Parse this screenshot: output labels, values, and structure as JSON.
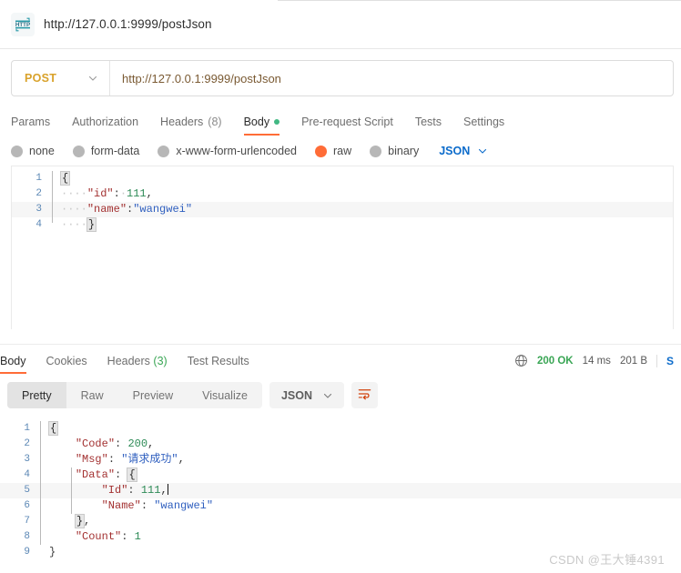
{
  "tab": {
    "icon": "http-badge-icon",
    "title": "http://127.0.0.1:9999/postJson"
  },
  "request": {
    "method": "POST",
    "method_chevron": "chevron-down-icon",
    "url": "http://127.0.0.1:9999/postJson",
    "tabs": [
      {
        "label": "Params",
        "active": false
      },
      {
        "label": "Authorization",
        "active": false
      },
      {
        "label": "Headers",
        "count": "(8)",
        "active": false
      },
      {
        "label": "Body",
        "active": true,
        "dot": true
      },
      {
        "label": "Pre-request Script",
        "active": false
      },
      {
        "label": "Tests",
        "active": false
      },
      {
        "label": "Settings",
        "active": false
      }
    ],
    "body_types": [
      {
        "label": "none",
        "selected": false
      },
      {
        "label": "form-data",
        "selected": false
      },
      {
        "label": "x-www-form-urlencoded",
        "selected": false
      },
      {
        "label": "raw",
        "selected": true
      },
      {
        "label": "binary",
        "selected": false
      }
    ],
    "format": "JSON",
    "format_chevron": "chevron-down-icon",
    "body_lines": [
      {
        "n": "1",
        "tokens": [
          {
            "t": "{",
            "c": "brace-box"
          }
        ]
      },
      {
        "n": "2",
        "tokens": [
          {
            "t": "····",
            "c": "ws"
          },
          {
            "t": "\"id\"",
            "c": "k"
          },
          {
            "t": ":",
            "c": "p"
          },
          {
            "t": "·",
            "c": "ws"
          },
          {
            "t": "111",
            "c": "n"
          },
          {
            "t": ",",
            "c": "p"
          }
        ]
      },
      {
        "n": "3",
        "tokens": [
          {
            "t": "····",
            "c": "ws"
          },
          {
            "t": "\"name\"",
            "c": "k"
          },
          {
            "t": ":",
            "c": "p"
          },
          {
            "t": "\"wangwei\"",
            "c": "s"
          }
        ],
        "hl": true
      },
      {
        "n": "4",
        "tokens": [
          {
            "t": "····",
            "c": "ws"
          },
          {
            "t": "}",
            "c": "brace-box"
          }
        ]
      }
    ]
  },
  "response": {
    "tabs": [
      {
        "label": "Body",
        "active": true
      },
      {
        "label": "Cookies",
        "active": false
      },
      {
        "label": "Headers",
        "count": "(3)",
        "active": false
      },
      {
        "label": "Test Results",
        "active": false
      }
    ],
    "globe_icon": "globe-icon",
    "status": "200 OK",
    "time": "14 ms",
    "size": "201 B",
    "save_label": "Save Response",
    "view_modes": [
      {
        "label": "Pretty",
        "active": true
      },
      {
        "label": "Raw",
        "active": false
      },
      {
        "label": "Preview",
        "active": false
      },
      {
        "label": "Visualize",
        "active": false
      }
    ],
    "format": "JSON",
    "format_chevron": "chevron-down-icon",
    "wrap_icon": "word-wrap-icon",
    "body_lines": [
      {
        "n": "1",
        "tokens": [
          {
            "t": "{",
            "c": "brace-box"
          }
        ]
      },
      {
        "n": "2",
        "tokens": [
          {
            "t": "    ",
            "c": "ws"
          },
          {
            "t": "\"Code\"",
            "c": "k"
          },
          {
            "t": ": ",
            "c": "p"
          },
          {
            "t": "200",
            "c": "n"
          },
          {
            "t": ",",
            "c": "p"
          }
        ]
      },
      {
        "n": "3",
        "tokens": [
          {
            "t": "    ",
            "c": "ws"
          },
          {
            "t": "\"Msg\"",
            "c": "k"
          },
          {
            "t": ": ",
            "c": "p"
          },
          {
            "t": "\"请求成功\"",
            "c": "s"
          },
          {
            "t": ",",
            "c": "p"
          }
        ]
      },
      {
        "n": "4",
        "tokens": [
          {
            "t": "    ",
            "c": "ws"
          },
          {
            "t": "\"Data\"",
            "c": "k"
          },
          {
            "t": ": ",
            "c": "p"
          },
          {
            "t": "{",
            "c": "brace-box"
          }
        ]
      },
      {
        "n": "5",
        "tokens": [
          {
            "t": "        ",
            "c": "ws"
          },
          {
            "t": "\"Id\"",
            "c": "k"
          },
          {
            "t": ": ",
            "c": "p"
          },
          {
            "t": "111",
            "c": "n"
          },
          {
            "t": ",",
            "c": "p"
          }
        ],
        "hl": true,
        "caret": true
      },
      {
        "n": "6",
        "tokens": [
          {
            "t": "        ",
            "c": "ws"
          },
          {
            "t": "\"Name\"",
            "c": "k"
          },
          {
            "t": ": ",
            "c": "p"
          },
          {
            "t": "\"wangwei\"",
            "c": "s"
          }
        ]
      },
      {
        "n": "7",
        "tokens": [
          {
            "t": "    ",
            "c": "ws"
          },
          {
            "t": "}",
            "c": "brace-box"
          },
          {
            "t": ",",
            "c": "p"
          }
        ]
      },
      {
        "n": "8",
        "tokens": [
          {
            "t": "    ",
            "c": "ws"
          },
          {
            "t": "\"Count\"",
            "c": "k"
          },
          {
            "t": ": ",
            "c": "p"
          },
          {
            "t": "1",
            "c": "n"
          }
        ]
      },
      {
        "n": "9",
        "tokens": [
          {
            "t": "}",
            "c": "p"
          }
        ]
      }
    ]
  },
  "watermark": "CSDN @王大锤4391",
  "colors": {
    "accent_orange": "#ff6c37",
    "method_post": "#d9a22b",
    "status_green": "#3aa655",
    "link_blue": "#0b6bcb"
  }
}
